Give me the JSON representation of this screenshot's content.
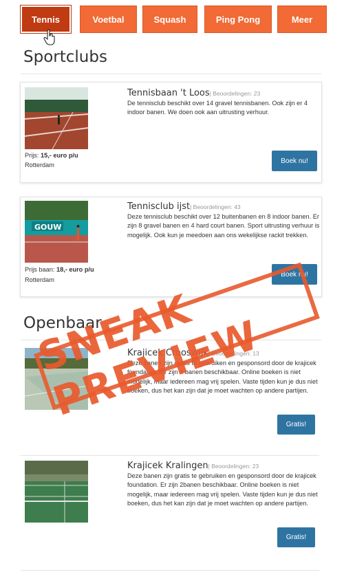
{
  "tabs": [
    {
      "label": "Tennis",
      "active": true
    },
    {
      "label": "Voetbal",
      "active": false
    },
    {
      "label": "Squash",
      "active": false
    },
    {
      "label": "Ping Pong",
      "active": false
    },
    {
      "label": "Meer",
      "active": false
    }
  ],
  "sections": {
    "sportclubs": "Sportclubs",
    "openbaar": "Openbaar"
  },
  "clubs": [
    {
      "name": "Tennisbaan 't Loos",
      "rating": "| Beoordelingen: 23",
      "description": "De tennisclub beschikt over 14 gravel tennisbanen. Ook zijn er 4 indoor banen. We doen ook aan uitrusting verhuur.",
      "price_label": "Prijs: ",
      "price_value": "15,- euro p/u",
      "city": "Rotterdam",
      "button": "Boek nu!"
    },
    {
      "name": "Tennisclub ijst",
      "rating": "| Beoordelingen: 43",
      "description": "Deze tennisclub beschikt over 12 buitenbanen en 8 indoor banen. Er zijn 8 gravel banen en 4 hard court banen. Sport uitrusting verhuur is mogelijk. Ook kun je meedoen aan ons wekelijkse rackit trekken.",
      "price_label": "Prijs baan: ",
      "price_value": "18,- euro p/u",
      "city": "Rotterdam",
      "button": "Boek nu!",
      "sign_text": "GOUW"
    }
  ],
  "public": [
    {
      "name": "Krajicek Crooswijk",
      "rating": "| Beoordelingen: 13",
      "description": "Deze banen zijn gratis te gebruiken en gesponsord door de krajicek foundation. Er zijn 4 banen beschikbaar. Online boeken is niet mogelijk, maar iedereen mag vrij spelen. Vaste tijden kun je dus niet boeken, dus het kan zijn dat je moet wachten op andere partijen.",
      "button": "Gratis!"
    },
    {
      "name": "Krajicek Kralingen",
      "rating": "| Beoordelingen: 23",
      "description": "Deze banen zijn gratis te gebruiken en gesponsord door de krajicek foundation. Er zijn 2banen beschikbaar. Online boeken is niet mogelijk, maar iedereen mag vrij spelen. Vaste tijden kun je dus niet boeken, dus het kan zijn dat je moet wachten op andere partijen.",
      "button": "Gratis!"
    }
  ],
  "stamp": "SNEAK PREVIEW",
  "colors": {
    "tab": "#f26a35",
    "tab_active": "#c03a12",
    "button": "#2e74a2",
    "stamp": "#e85a2d"
  }
}
